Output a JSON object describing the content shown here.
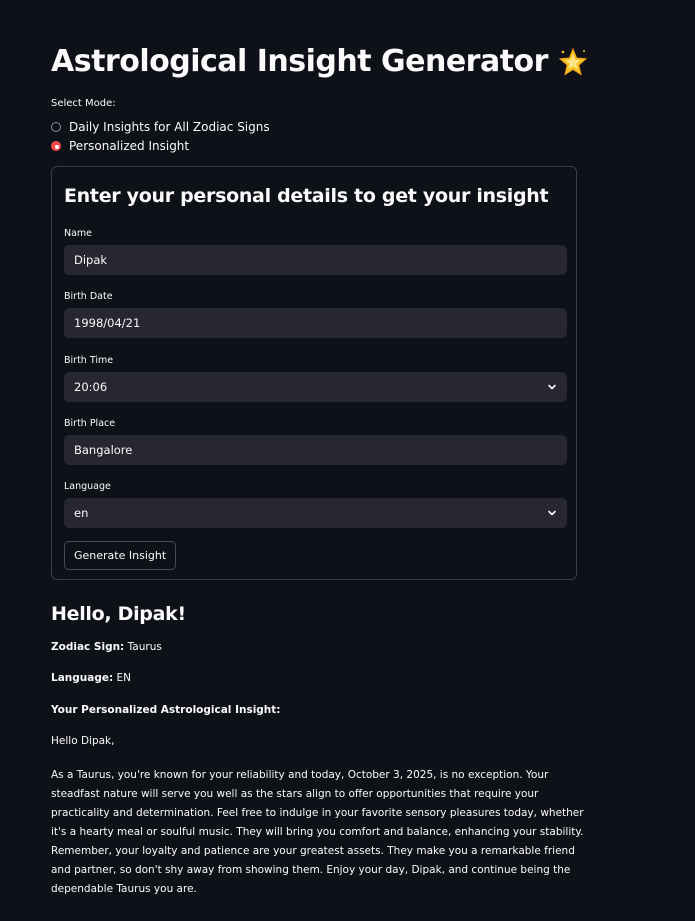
{
  "header": {
    "title": "Astrological Insight Generator",
    "title_icon": "glowing-star-icon"
  },
  "mode": {
    "label": "Select Mode:",
    "options": [
      {
        "label": "Daily Insights for All Zodiac Signs",
        "selected": false
      },
      {
        "label": "Personalized Insight",
        "selected": true
      }
    ]
  },
  "form": {
    "heading": "Enter your personal details to get your insight",
    "fields": {
      "name": {
        "label": "Name",
        "value": "Dipak"
      },
      "birth_date": {
        "label": "Birth Date",
        "value": "1998/04/21"
      },
      "birth_time": {
        "label": "Birth Time",
        "value": "20:06"
      },
      "birth_place": {
        "label": "Birth Place",
        "value": "Bangalore"
      },
      "language": {
        "label": "Language",
        "value": "en"
      }
    },
    "submit_label": "Generate Insight"
  },
  "result": {
    "greeting": "Hello, Dipak!",
    "zodiac_label": "Zodiac Sign:",
    "zodiac_value": "Taurus",
    "language_label": "Language:",
    "language_value": "EN",
    "insight_heading": "Your Personalized Astrological Insight:",
    "salutation": "Hello Dipak,",
    "insight_text": "As a Taurus, you're known for your reliability and today, October 3, 2025, is no exception. Your steadfast nature will serve you well as the stars align to offer opportunities that require your practicality and determination. Feel free to indulge in your favorite sensory pleasures today, whether it's a hearty meal or soulful music. They will bring you comfort and balance, enhancing your stability. Remember, your loyalty and patience are your greatest assets. They make you a remarkable friend and partner, so don't shy away from showing them. Enjoy your day, Dipak, and continue being the dependable Taurus you are."
  },
  "colors": {
    "background": "#0e1117",
    "input_background": "#262730",
    "accent": "#ff4b4b",
    "text": "#fafafa"
  }
}
